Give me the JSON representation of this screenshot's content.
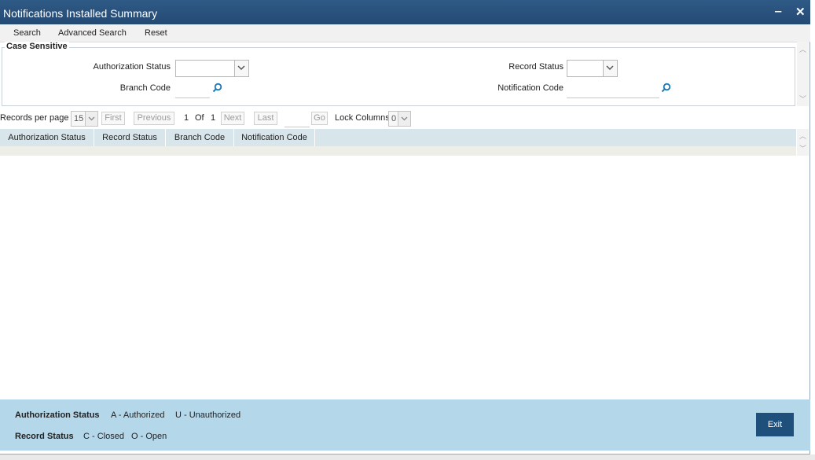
{
  "window": {
    "title": "Notifications Installed Summary",
    "minimize": "‒",
    "close": "✕"
  },
  "menu": {
    "search": "Search",
    "advanced_search": "Advanced Search",
    "reset": "Reset"
  },
  "criteria": {
    "legend": "Case Sensitive",
    "authorization_status_label": "Authorization Status",
    "authorization_status_value": "",
    "record_status_label": "Record Status",
    "record_status_value": "",
    "branch_code_label": "Branch Code",
    "branch_code_value": "",
    "notification_code_label": "Notification Code",
    "notification_code_value": ""
  },
  "pager": {
    "records_per_page_label": "Records per page",
    "records_per_page": "15",
    "first": "First",
    "previous": "Previous",
    "current_page": "1",
    "of_label": "Of",
    "total_pages": "1",
    "next": "Next",
    "last": "Last",
    "go": "Go",
    "lock_columns_label": "Lock Columns",
    "lock_columns": "0"
  },
  "grid": {
    "columns": [
      "Authorization Status",
      "Record Status",
      "Branch Code",
      "Notification Code"
    ]
  },
  "legend_bar": {
    "auth_key": "Authorization Status",
    "auth_a": "A - Authorized",
    "auth_u": "U - Unauthorized",
    "record_key": "Record Status",
    "record_c": "C - Closed",
    "record_o": "O - Open"
  },
  "buttons": {
    "exit": "Exit"
  },
  "colors": {
    "titlebar": "#2f5a86",
    "grid_header": "#d8e5ea",
    "legend_bar": "#b5d7ea",
    "exit_button": "#1f4f7b",
    "search_icon": "#1a78b8"
  }
}
